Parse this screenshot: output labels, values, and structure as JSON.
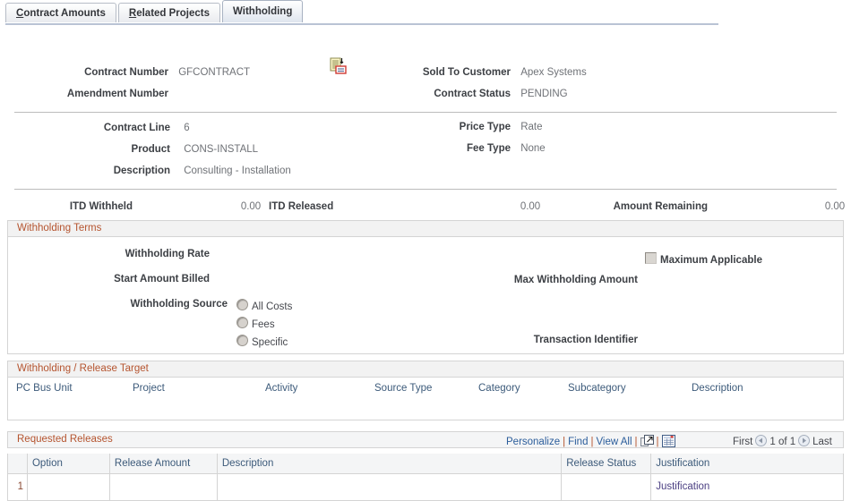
{
  "tabs": [
    {
      "label": "Contract Amounts",
      "accel": "C",
      "rest": "ontract Amounts",
      "active": false
    },
    {
      "label": "Related Projects",
      "accel": "R",
      "rest": "elated Projects",
      "active": false
    },
    {
      "label": "Withholding",
      "accel": "",
      "rest": "Withholding",
      "active": true
    }
  ],
  "header": {
    "contract_number_label": "Contract Number",
    "contract_number_value": "GFCONTRACT",
    "amendment_number_label": "Amendment Number",
    "amendment_number_value": "",
    "sold_to_customer_label": "Sold To Customer",
    "sold_to_customer_value": "Apex Systems",
    "contract_status_label": "Contract Status",
    "contract_status_value": "PENDING",
    "notes_icon": "notes-document-icon"
  },
  "line": {
    "contract_line_label": "Contract Line",
    "contract_line_value": "6",
    "product_label": "Product",
    "product_value": "CONS-INSTALL",
    "description_label": "Description",
    "description_value": "Consulting - Installation",
    "price_type_label": "Price Type",
    "price_type_value": "Rate",
    "fee_type_label": "Fee Type",
    "fee_type_value": "None"
  },
  "totals": {
    "itd_withheld_label": "ITD Withheld",
    "itd_withheld_value": "0.00",
    "itd_released_label": "ITD Released",
    "itd_released_value": "0.00",
    "amount_remaining_label": "Amount Remaining",
    "amount_remaining_value": "0.00"
  },
  "withholding_terms": {
    "title": "Withholding Terms",
    "withholding_rate_label": "Withholding Rate",
    "withholding_rate_value": "",
    "start_amount_billed_label": "Start Amount Billed",
    "start_amount_billed_value": "",
    "withholding_source_label": "Withholding Source",
    "source_options": [
      {
        "label": "All Costs",
        "selected": false
      },
      {
        "label": "Fees",
        "selected": false
      },
      {
        "label": "Specific",
        "selected": false
      }
    ],
    "maximum_applicable_label": "Maximum Applicable",
    "maximum_applicable_checked": false,
    "max_withholding_amount_label": "Max Withholding Amount",
    "max_withholding_amount_value": "",
    "transaction_identifier_label": "Transaction Identifier",
    "transaction_identifier_value": ""
  },
  "release_target": {
    "title": "Withholding / Release Target",
    "columns": [
      "PC Bus Unit",
      "Project",
      "Activity",
      "Source Type",
      "Category",
      "Subcategory",
      "Description"
    ]
  },
  "requested_releases": {
    "title": "Requested Releases",
    "toolbar": {
      "personalize": "Personalize",
      "find": "Find",
      "view_all": "View All",
      "separator": "|",
      "expand_icon": "expand-all-icon",
      "grid_icon": "download-to-spreadsheet-icon"
    },
    "pager": {
      "first": "First",
      "prev_icon": "previous-page-arrow-icon",
      "count": "1 of 1",
      "next_icon": "next-page-arrow-icon",
      "last": "Last"
    },
    "columns": [
      "Option",
      "Release Amount",
      "Description",
      "Release Status",
      "Justification"
    ],
    "rows": [
      {
        "num": "1",
        "option": "",
        "release_amount": "",
        "description": "",
        "release_status": "",
        "justification": "Justification"
      }
    ]
  },
  "colors": {
    "section_title": "#b5542f",
    "link": "#2b5d9b",
    "cell_link": "#4b3f82",
    "label": "#3d4045",
    "value": "#6f7277",
    "column_header": "#3c5a7a",
    "band_bg": "#f2f2f2",
    "border": "#d4d4d4"
  }
}
